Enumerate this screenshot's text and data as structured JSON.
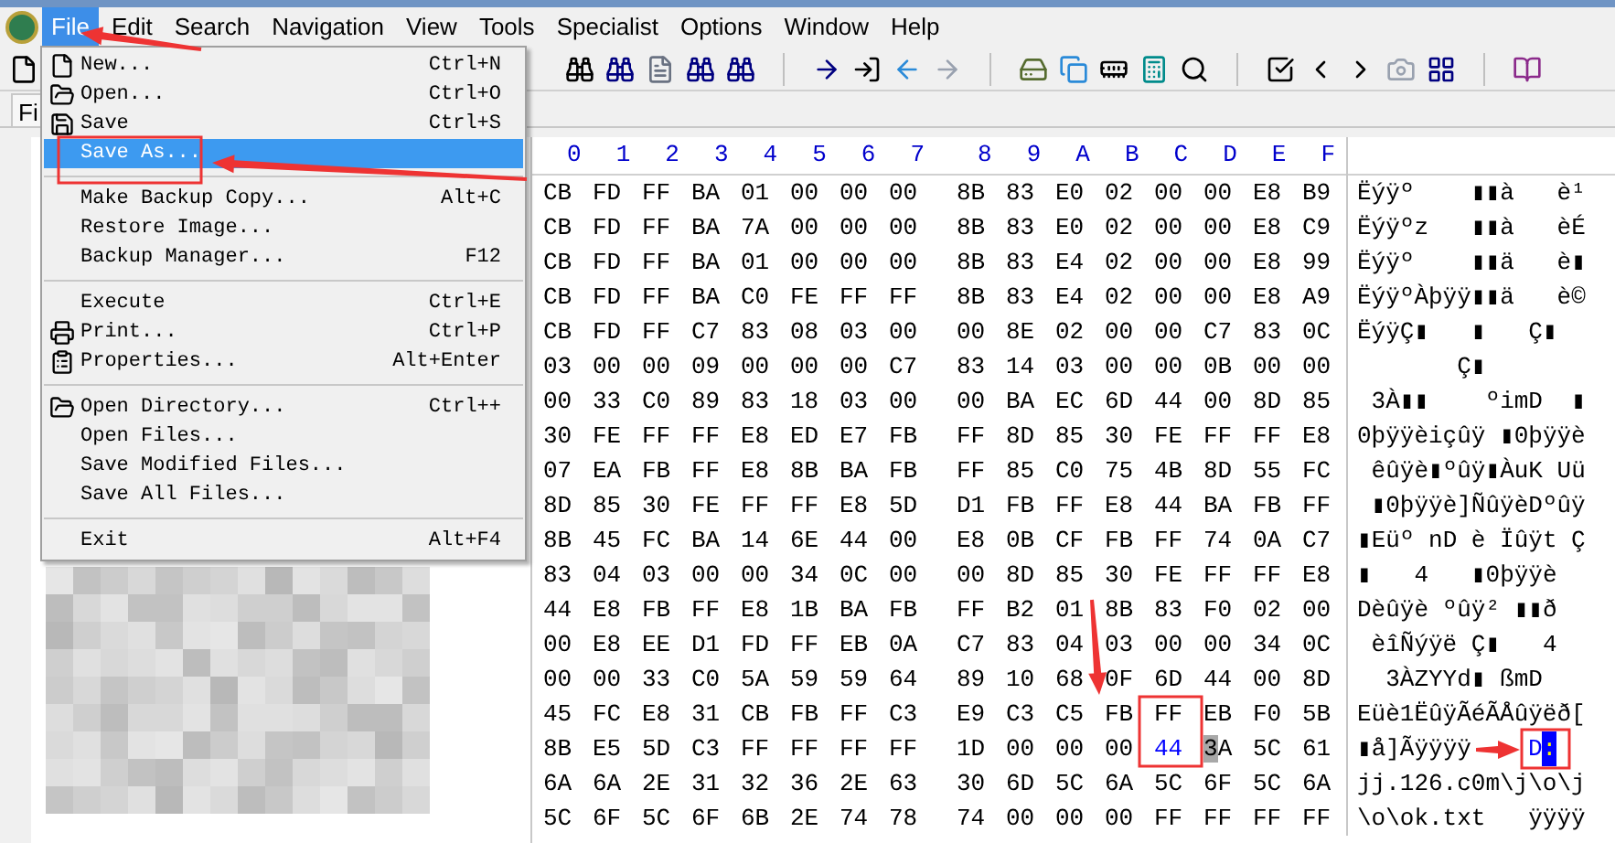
{
  "menu_bar": [
    {
      "label": "File",
      "selected": true
    },
    {
      "label": "Edit",
      "selected": false
    },
    {
      "label": "Search",
      "selected": false
    },
    {
      "label": "Navigation",
      "selected": false
    },
    {
      "label": "View",
      "selected": false
    },
    {
      "label": "Tools",
      "selected": false
    },
    {
      "label": "Specialist",
      "selected": false
    },
    {
      "label": "Options",
      "selected": false
    },
    {
      "label": "Window",
      "selected": false
    },
    {
      "label": "Help",
      "selected": false
    }
  ],
  "tab": {
    "label": "Fi"
  },
  "file_menu": [
    [
      {
        "label": "New...",
        "shortcut": "Ctrl+N",
        "selected": false
      },
      {
        "label": "Open...",
        "shortcut": "Ctrl+O",
        "selected": false
      },
      {
        "label": "Save",
        "shortcut": "Ctrl+S",
        "selected": false
      },
      {
        "label": "Save As...",
        "selected": true
      }
    ],
    [
      {
        "label": "Make Backup Copy...",
        "shortcut": "Alt+C",
        "selected": false
      },
      {
        "label": "Restore Image...",
        "selected": false
      },
      {
        "label": "Backup Manager...",
        "shortcut": "F12",
        "selected": false
      }
    ],
    [
      {
        "label": "Execute",
        "shortcut": "Ctrl+E",
        "selected": false
      },
      {
        "label": "Print...",
        "shortcut": "Ctrl+P",
        "selected": false
      },
      {
        "label": "Properties...",
        "shortcut": "Alt+Enter",
        "selected": false
      }
    ],
    [
      {
        "label": "Open Directory...",
        "shortcut": "Ctrl++",
        "selected": false
      },
      {
        "label": "Open Files...",
        "selected": false
      },
      {
        "label": "Save Modified Files...",
        "selected": false
      },
      {
        "label": "Save All Files...",
        "selected": false
      }
    ],
    [
      {
        "label": "Exit",
        "shortcut": "Alt+F4",
        "selected": false
      }
    ]
  ],
  "hex_header": [
    "0",
    "1",
    "2",
    "3",
    "4",
    "5",
    "6",
    "7",
    "8",
    "9",
    "A",
    "B",
    "C",
    "D",
    "E",
    "F"
  ],
  "hex_rows": [
    {
      "hex": [
        "CB",
        "FD",
        "FF",
        "BA",
        "01",
        "00",
        "00",
        "00",
        "8B",
        "83",
        "E0",
        "02",
        "00",
        "00",
        "E8",
        "B9"
      ],
      "text": "Ëýÿº    ▮▮à   è¹"
    },
    {
      "hex": [
        "CB",
        "FD",
        "FF",
        "BA",
        "7A",
        "00",
        "00",
        "00",
        "8B",
        "83",
        "E0",
        "02",
        "00",
        "00",
        "E8",
        "C9"
      ],
      "text": "Ëýÿºz   ▮▮à   èÉ"
    },
    {
      "hex": [
        "CB",
        "FD",
        "FF",
        "BA",
        "01",
        "00",
        "00",
        "00",
        "8B",
        "83",
        "E4",
        "02",
        "00",
        "00",
        "E8",
        "99"
      ],
      "text": "Ëýÿº    ▮▮ä   è▮"
    },
    {
      "hex": [
        "CB",
        "FD",
        "FF",
        "BA",
        "C0",
        "FE",
        "FF",
        "FF",
        "8B",
        "83",
        "E4",
        "02",
        "00",
        "00",
        "E8",
        "A9"
      ],
      "text": "ËýÿºÀþÿÿ▮▮ä   è©"
    },
    {
      "hex": [
        "CB",
        "FD",
        "FF",
        "C7",
        "83",
        "08",
        "03",
        "00",
        "00",
        "8E",
        "02",
        "00",
        "00",
        "C7",
        "83",
        "0C"
      ],
      "text": "ËýÿÇ▮   ▮   Ç▮"
    },
    {
      "hex": [
        "03",
        "00",
        "00",
        "09",
        "00",
        "00",
        "00",
        "C7",
        "83",
        "14",
        "03",
        "00",
        "00",
        "0B",
        "00",
        "00"
      ],
      "text": "       Ç▮"
    },
    {
      "hex": [
        "00",
        "33",
        "C0",
        "89",
        "83",
        "18",
        "03",
        "00",
        "00",
        "BA",
        "EC",
        "6D",
        "44",
        "00",
        "8D",
        "85"
      ],
      "text": " 3À▮▮    ºimD  ▮"
    },
    {
      "hex": [
        "30",
        "FE",
        "FF",
        "FF",
        "E8",
        "ED",
        "E7",
        "FB",
        "FF",
        "8D",
        "85",
        "30",
        "FE",
        "FF",
        "FF",
        "E8"
      ],
      "text": "0þÿÿèiçûÿ ▮0þÿÿè"
    },
    {
      "hex": [
        "07",
        "EA",
        "FB",
        "FF",
        "E8",
        "8B",
        "BA",
        "FB",
        "FF",
        "85",
        "C0",
        "75",
        "4B",
        "8D",
        "55",
        "FC"
      ],
      "text": " êûÿè▮ºûÿ▮ÀuK Uü"
    },
    {
      "hex": [
        "8D",
        "85",
        "30",
        "FE",
        "FF",
        "FF",
        "E8",
        "5D",
        "D1",
        "FB",
        "FF",
        "E8",
        "44",
        "BA",
        "FB",
        "FF"
      ],
      "text": " ▮0þÿÿè]ÑûÿèDºûÿ"
    },
    {
      "hex": [
        "8B",
        "45",
        "FC",
        "BA",
        "14",
        "6E",
        "44",
        "00",
        "E8",
        "0B",
        "CF",
        "FB",
        "FF",
        "74",
        "0A",
        "C7"
      ],
      "text": "▮Eüº nD è Ïûÿt Ç"
    },
    {
      "hex": [
        "83",
        "04",
        "03",
        "00",
        "00",
        "34",
        "0C",
        "00",
        "00",
        "8D",
        "85",
        "30",
        "FE",
        "FF",
        "FF",
        "E8"
      ],
      "text": "▮   4   ▮0þÿÿè"
    },
    {
      "hex": [
        "44",
        "E8",
        "FB",
        "FF",
        "E8",
        "1B",
        "BA",
        "FB",
        "FF",
        "B2",
        "01",
        "8B",
        "83",
        "F0",
        "02",
        "00"
      ],
      "text": "Dèûÿè ºûÿ² ▮▮ð"
    },
    {
      "hex": [
        "00",
        "E8",
        "EE",
        "D1",
        "FD",
        "FF",
        "EB",
        "0A",
        "C7",
        "83",
        "04",
        "03",
        "00",
        "00",
        "34",
        "0C"
      ],
      "text": " èîÑýÿë Ç▮   4"
    },
    {
      "hex": [
        "00",
        "00",
        "33",
        "C0",
        "5A",
        "59",
        "59",
        "64",
        "89",
        "10",
        "68",
        "0F",
        "6D",
        "44",
        "00",
        "8D"
      ],
      "text": "  3ÀZYYd▮ ßmD"
    },
    {
      "hex": [
        "45",
        "FC",
        "E8",
        "31",
        "CB",
        "FB",
        "FF",
        "C3",
        "E9",
        "C3",
        "C5",
        "FB",
        "FF",
        "EB",
        "F0",
        "5B"
      ],
      "text": "Eüè1ËûÿÃéÃÅûÿëð["
    },
    {
      "hex": [
        "8B",
        "E5",
        "5D",
        "C3",
        "FF",
        "FF",
        "FF",
        "FF",
        "1D",
        "00",
        "00",
        "00",
        {
          "value": "44",
          "kind": "cursor"
        },
        {
          "value": "3A",
          "kind": "caret"
        },
        "5C",
        "61"
      ],
      "text": [
        {
          "value": "▮å]Ãÿÿÿÿ",
          "kind": "plain"
        },
        {
          "value": "D",
          "kind": "cursor"
        },
        {
          "value": ":",
          "kind": "caret"
        }
      ]
    },
    {
      "hex": [
        "6A",
        "6A",
        "2E",
        "31",
        "32",
        "36",
        "2E",
        "63",
        "30",
        "6D",
        "5C",
        "6A",
        "5C",
        "6F",
        "5C",
        "6A"
      ],
      "text": "jj.126.c0m\\j\\o\\j"
    },
    {
      "hex": [
        "5C",
        "6F",
        "5C",
        "6F",
        "6B",
        "2E",
        "74",
        "78",
        "74",
        "00",
        "00",
        "00",
        "FF",
        "FF",
        "FF",
        "FF"
      ],
      "text": "\\o\\ok.txt   ÿÿÿÿ"
    }
  ]
}
